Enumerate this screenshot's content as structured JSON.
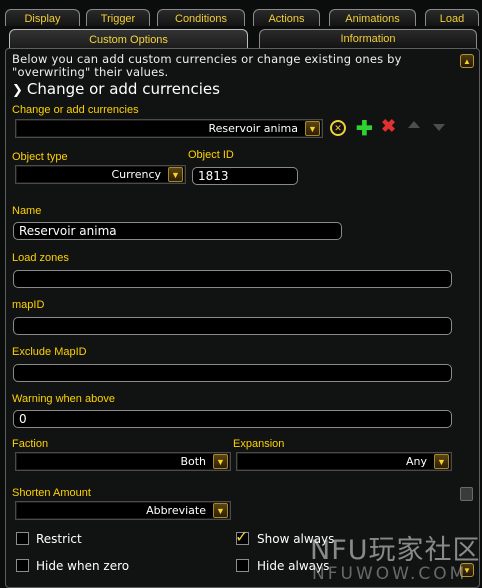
{
  "tabs_row1": [
    {
      "label": "Display"
    },
    {
      "label": "Trigger"
    },
    {
      "label": "Conditions"
    },
    {
      "label": "Actions"
    },
    {
      "label": "Animations"
    },
    {
      "label": "Load"
    }
  ],
  "tabs_row2": [
    {
      "label": "Custom Options"
    },
    {
      "label": "Information"
    }
  ],
  "description": "Below you can add custom currencies or change existing ones by \"overwriting\" their values.",
  "section_header": "Change or add currencies",
  "change_add": {
    "label": "Change or add currencies",
    "selected": "Reservoir anima"
  },
  "object_type": {
    "label": "Object type",
    "selected": "Currency"
  },
  "object_id": {
    "label": "Object ID",
    "value": "1813"
  },
  "name": {
    "label": "Name",
    "value": "Reservoir anima"
  },
  "load_zones": {
    "label": "Load zones",
    "value": ""
  },
  "map_id": {
    "label": "mapID",
    "value": ""
  },
  "exclude_map_id": {
    "label": "Exclude MapID",
    "value": ""
  },
  "warning_above": {
    "label": "Warning when above",
    "value": "0"
  },
  "faction": {
    "label": "Faction",
    "selected": "Both"
  },
  "expansion": {
    "label": "Expansion",
    "selected": "Any"
  },
  "shorten": {
    "label": "Shorten Amount",
    "selected": "Abbreviate"
  },
  "checkboxes": {
    "restrict": {
      "label": "Restrict",
      "checked": false
    },
    "show_always": {
      "label": "Show always",
      "checked": true
    },
    "hide_when_zero": {
      "label": "Hide when zero",
      "checked": false
    },
    "hide_always": {
      "label": "Hide always",
      "checked": false
    }
  },
  "watermark": {
    "brand_cn": "NFU玩家社区",
    "url": "NFUWOW.COM"
  },
  "colors": {
    "gold_label": "#ffd200",
    "tab_text": "#f2cf33",
    "add_icon": "#2fd22f",
    "delete_icon": "#e03030"
  }
}
